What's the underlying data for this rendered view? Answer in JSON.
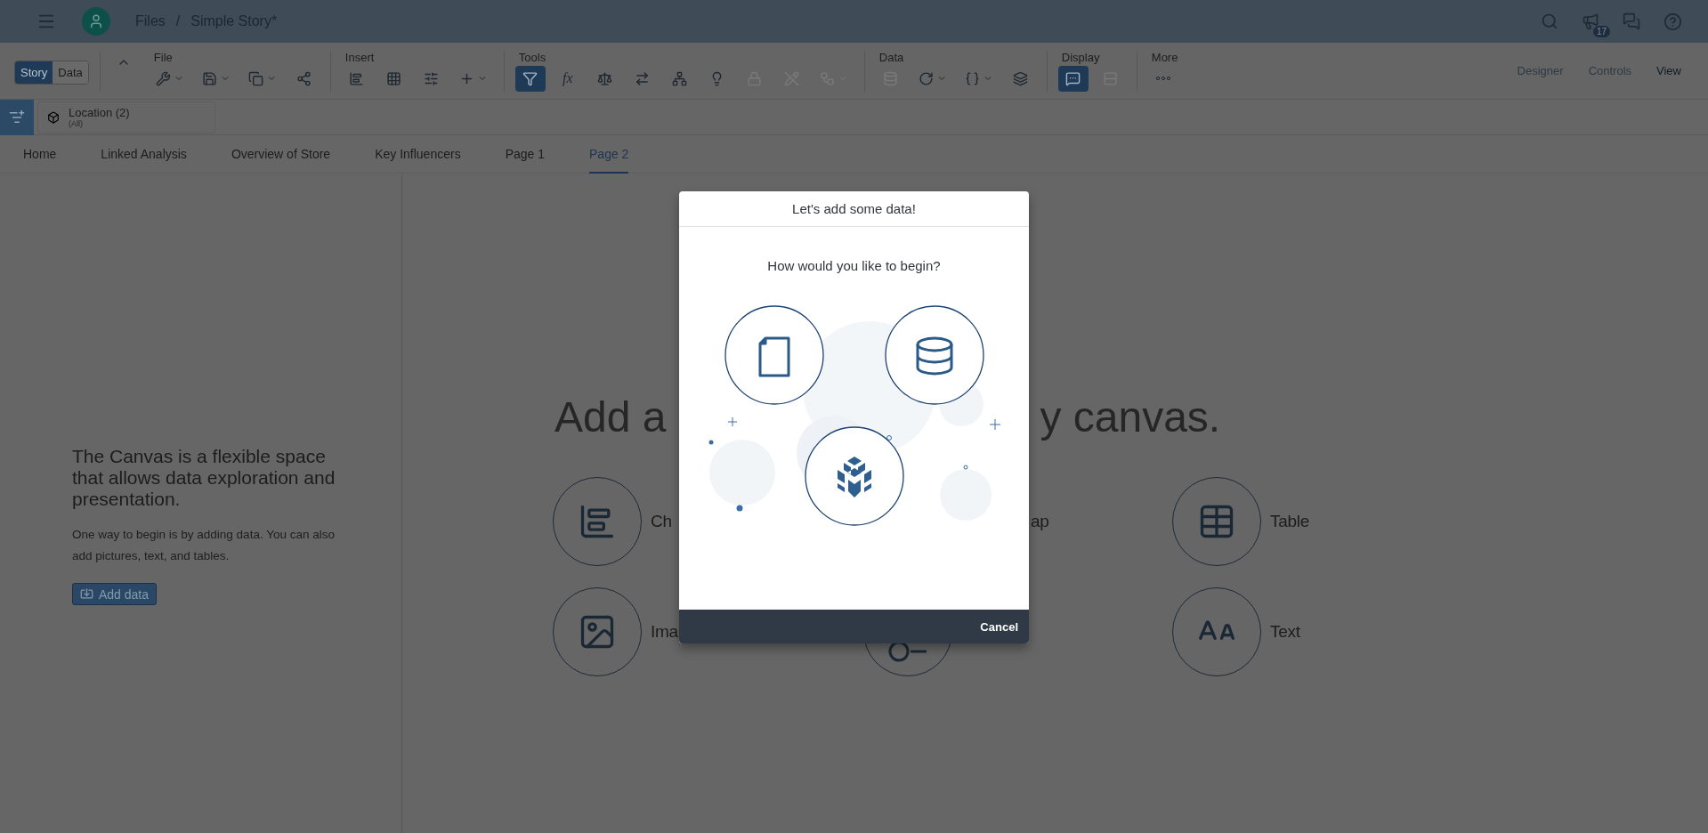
{
  "shell": {
    "breadcrumb": [
      "Files",
      "/",
      "Simple Story*"
    ],
    "notifications": "17"
  },
  "toolbar": {
    "view_toggle": [
      {
        "label": "Story",
        "selected": true
      },
      {
        "label": "Data",
        "selected": false
      }
    ],
    "groups": [
      {
        "label": "File",
        "tools": [
          {
            "kind": "wrench",
            "active": false,
            "disabled": false,
            "dropdown": true
          },
          {
            "kind": "save",
            "active": false,
            "disabled": false,
            "dropdown": true
          },
          {
            "kind": "copy",
            "active": false,
            "disabled": false,
            "dropdown": true
          },
          {
            "kind": "share",
            "active": false,
            "disabled": false,
            "dropdown": false
          }
        ]
      },
      {
        "label": "Insert",
        "tools": [
          {
            "kind": "chart",
            "active": false,
            "disabled": false,
            "dropdown": false
          },
          {
            "kind": "grid",
            "active": false,
            "disabled": false,
            "dropdown": false
          },
          {
            "kind": "sliders",
            "active": false,
            "disabled": false,
            "dropdown": false
          },
          {
            "kind": "plus",
            "active": false,
            "disabled": false,
            "dropdown": true
          }
        ]
      },
      {
        "label": "Tools",
        "tools": [
          {
            "kind": "filter",
            "active": true,
            "disabled": false,
            "dropdown": false
          },
          {
            "kind": "function",
            "glyph": "fx",
            "active": false,
            "disabled": false,
            "dropdown": false
          },
          {
            "kind": "scale",
            "active": false,
            "disabled": false,
            "dropdown": false
          },
          {
            "kind": "compare",
            "active": false,
            "disabled": false,
            "dropdown": false
          },
          {
            "kind": "network",
            "active": false,
            "disabled": false,
            "dropdown": false
          },
          {
            "kind": "bulb",
            "active": false,
            "disabled": false,
            "dropdown": false
          },
          {
            "kind": "lock",
            "active": false,
            "disabled": true,
            "dropdown": false
          },
          {
            "kind": "pencil",
            "active": false,
            "disabled": true,
            "dropdown": false
          },
          {
            "kind": "workflow",
            "active": false,
            "disabled": true,
            "dropdown": true
          }
        ]
      },
      {
        "label": "Data",
        "tools": [
          {
            "kind": "database",
            "active": false,
            "disabled": true,
            "dropdown": false
          },
          {
            "kind": "refresh",
            "active": false,
            "disabled": false,
            "dropdown": true
          },
          {
            "kind": "braces",
            "active": false,
            "disabled": false,
            "dropdown": true
          },
          {
            "kind": "layers",
            "active": false,
            "disabled": false,
            "dropdown": false
          }
        ]
      },
      {
        "label": "Display",
        "tools": [
          {
            "kind": "comment",
            "active": true,
            "disabled": false,
            "dropdown": false
          },
          {
            "kind": "rows",
            "active": false,
            "disabled": true,
            "dropdown": false
          }
        ]
      },
      {
        "label": "More",
        "tools": [
          {
            "kind": "more",
            "active": false,
            "disabled": false,
            "dropdown": false
          }
        ]
      }
    ],
    "modes": [
      {
        "label": "Designer",
        "selected": false
      },
      {
        "label": "Controls",
        "selected": false
      },
      {
        "label": "View",
        "selected": true
      }
    ]
  },
  "filter_bar": {
    "token": {
      "label": "Location (2)",
      "value": "(All)"
    }
  },
  "page_tabs": [
    {
      "label": "Home",
      "selected": false
    },
    {
      "label": "Linked Analysis",
      "selected": false
    },
    {
      "label": "Overview of Store",
      "selected": false
    },
    {
      "label": "Key Influencers",
      "selected": false
    },
    {
      "label": "Page 1",
      "selected": false
    },
    {
      "label": "Page 2",
      "selected": true
    }
  ],
  "side_panel": {
    "heading": "The Canvas is a flexible space that allows data exploration and presentation.",
    "text": "One way to begin is by adding data. You can also add pictures, text, and tables.",
    "button": "Add data"
  },
  "canvas": {
    "heading_parts": [
      "Add a",
      "y canvas."
    ],
    "items": [
      {
        "kind": "chart",
        "label": "Ch"
      },
      {
        "kind": "map",
        "label": "ap"
      },
      {
        "kind": "table",
        "label": "Table"
      },
      {
        "kind": "image",
        "label": "Ima"
      },
      {
        "kind": "input"
      },
      {
        "kind": "text",
        "label": "Text"
      }
    ]
  },
  "dialog": {
    "title": "Let's add some data!",
    "prompt": "How would you like to begin?",
    "options": [
      {
        "kind": "file"
      },
      {
        "kind": "database"
      },
      {
        "kind": "model"
      }
    ],
    "buttons": [
      "Cancel"
    ]
  }
}
